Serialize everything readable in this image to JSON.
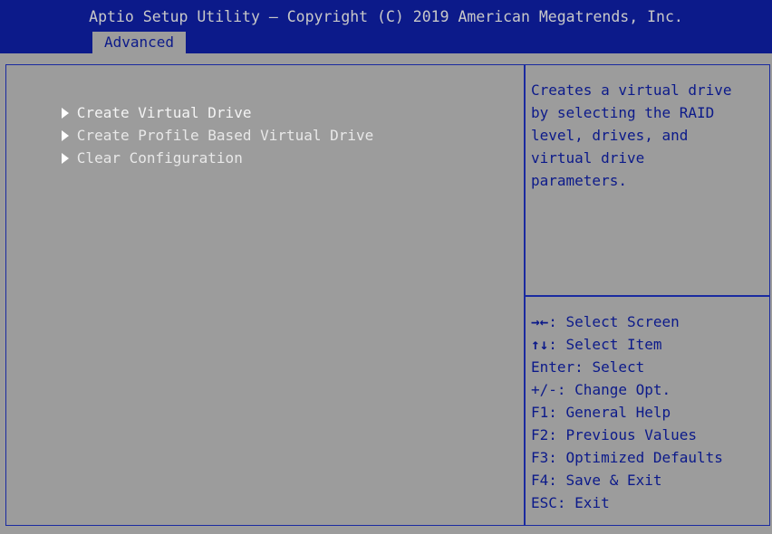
{
  "header": {
    "title": "Aptio Setup Utility – Copyright (C) 2019 American Megatrends, Inc.",
    "active_tab": "Advanced"
  },
  "menu": {
    "items": [
      {
        "label": "Create Virtual Drive"
      },
      {
        "label": "Create Profile Based Virtual Drive"
      },
      {
        "label": "Clear Configuration"
      }
    ]
  },
  "help": {
    "lines": [
      "Creates a virtual drive",
      "by selecting the RAID",
      "level, drives, and",
      "virtual drive",
      "parameters."
    ]
  },
  "keys": [
    {
      "key": "→←",
      "desc": ": Select Screen"
    },
    {
      "key": "↑↓",
      "desc": ": Select Item"
    },
    {
      "key": "Enter",
      "desc": ": Select"
    },
    {
      "key": "+/-",
      "desc": ": Change Opt."
    },
    {
      "key": "F1",
      "desc": ": General Help"
    },
    {
      "key": "F2",
      "desc": ": Previous Values"
    },
    {
      "key": "F3",
      "desc": ": Optimized Defaults"
    },
    {
      "key": "F4",
      "desc": ": Save & Exit"
    },
    {
      "key": "ESC",
      "desc": ": Exit"
    }
  ],
  "colors": {
    "header_bg": "#0c1a8a",
    "body_bg": "#9c9c9c",
    "text_blue": "#0c1a8a",
    "menu_text": "#e8e8e8"
  }
}
